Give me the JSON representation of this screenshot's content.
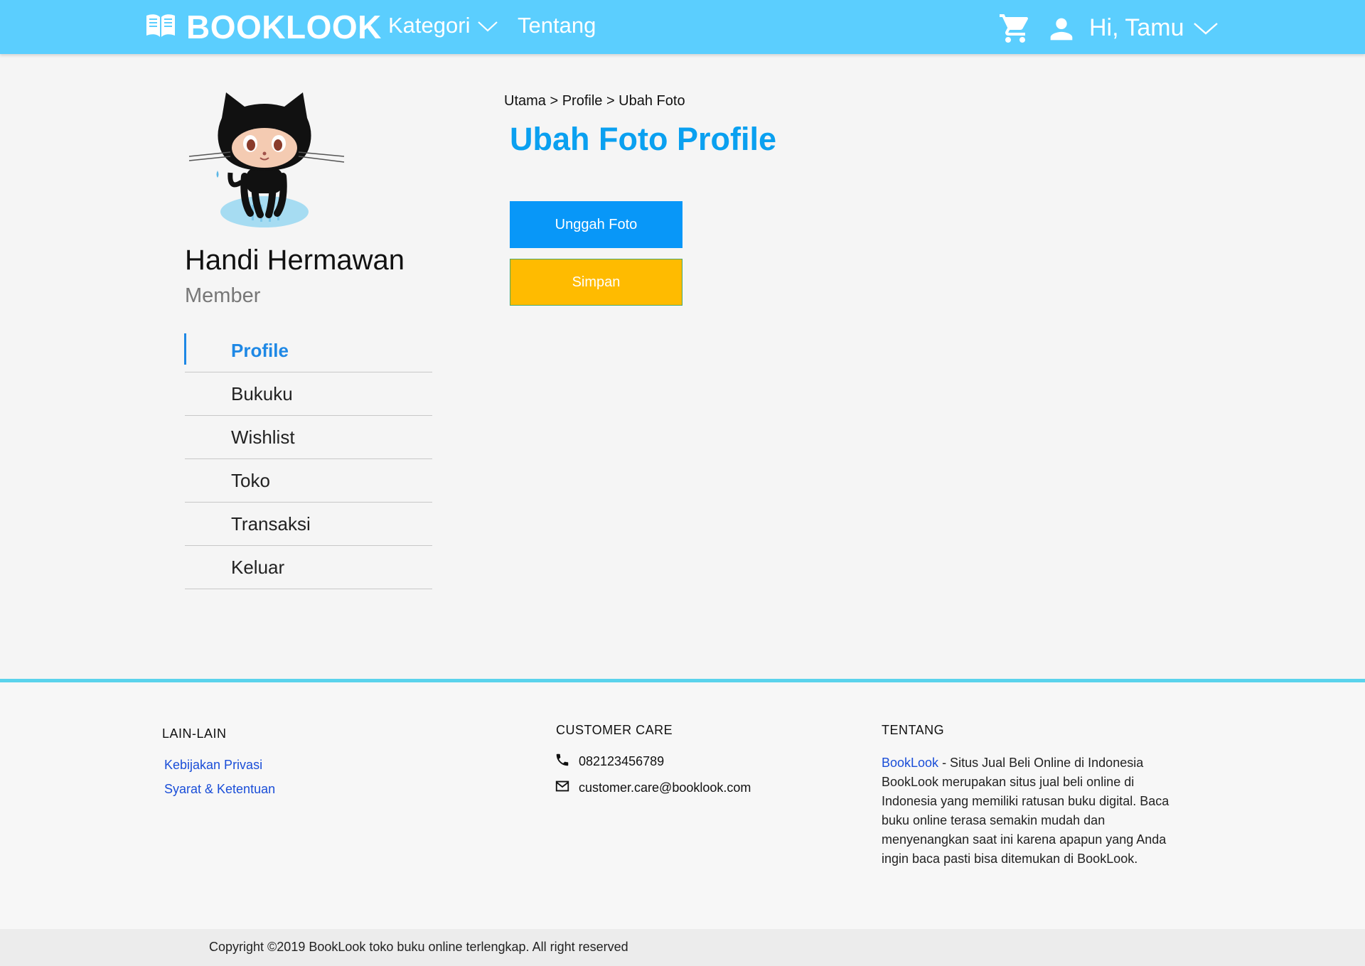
{
  "colors": {
    "header_bg": "#5bcefe",
    "accent_blue": "#0aa0f0",
    "button_blue": "#0897f8",
    "button_yellow": "#ffbb00",
    "link_blue": "#1a4ed8",
    "footer_line": "#5ad3ec"
  },
  "header": {
    "brand_icon": "book-open-icon",
    "brand": "BOOKLOOK",
    "nav": {
      "kategori": "Kategori",
      "tentang": "Tentang"
    },
    "cart_icon": "cart-icon",
    "user_icon": "user-icon",
    "greeting": "Hi, Tamu"
  },
  "sidebar": {
    "avatar_icon": "octocat-avatar",
    "name": "Handi Hermawan",
    "role": "Member",
    "items": [
      {
        "label": "Profile",
        "active": true
      },
      {
        "label": "Bukuku",
        "active": false
      },
      {
        "label": "Wishlist",
        "active": false
      },
      {
        "label": "Toko",
        "active": false
      },
      {
        "label": "Transaksi",
        "active": false
      },
      {
        "label": "Keluar",
        "active": false
      }
    ]
  },
  "main": {
    "breadcrumb": "Utama > Profile > Ubah Foto",
    "title": "Ubah Foto Profile",
    "upload_label": "Unggah Foto",
    "save_label": "Simpan"
  },
  "footer": {
    "lain": {
      "heading": "LAIN-LAIN",
      "links": [
        "Kebijakan Privasi",
        "Syarat & Ketentuan"
      ]
    },
    "care": {
      "heading": "CUSTOMER CARE",
      "phone_icon": "phone-icon",
      "phone": "082123456789",
      "mail_icon": "mail-icon",
      "email": "customer.care@booklook.com"
    },
    "tentang": {
      "heading": "TENTANG",
      "link": "BookLook",
      "text": " - Situs Jual Beli Online di Indonesia BookLook merupakan situs jual beli online di Indonesia yang memiliki ratusan buku digital. Baca buku online terasa semakin mudah dan menyenangkan saat ini karena apapun yang Anda ingin baca pasti bisa ditemukan di BookLook."
    },
    "copyright": "Copyright ©2019 BookLook toko buku online terlengkap. All right reserved"
  }
}
